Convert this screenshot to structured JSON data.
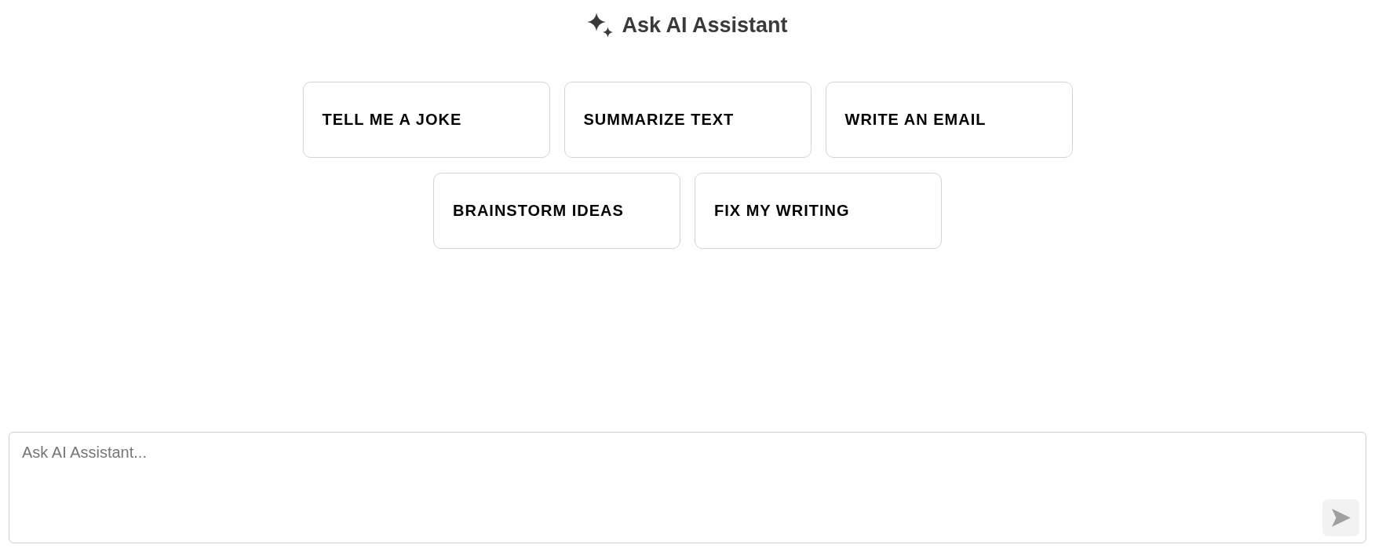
{
  "header": {
    "title": "Ask AI Assistant"
  },
  "suggestions": [
    {
      "label": "TELL ME A JOKE"
    },
    {
      "label": "SUMMARIZE TEXT"
    },
    {
      "label": "WRITE AN EMAIL"
    },
    {
      "label": "BRAINSTORM IDEAS"
    },
    {
      "label": "FIX MY WRITING"
    }
  ],
  "composer": {
    "placeholder": "Ask AI Assistant...",
    "send_button": {
      "disabled": true
    }
  }
}
